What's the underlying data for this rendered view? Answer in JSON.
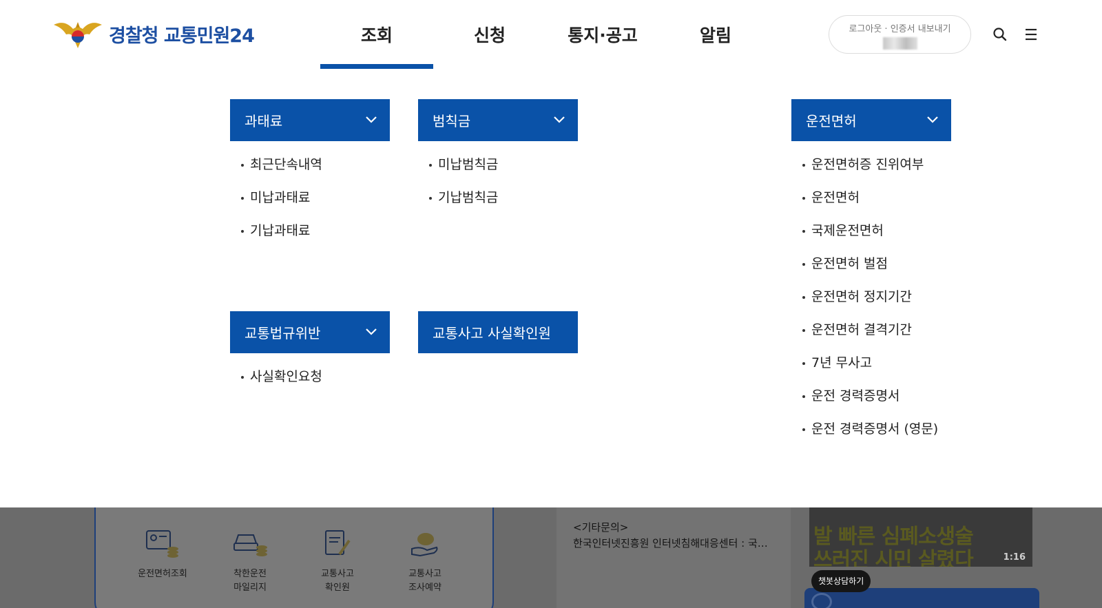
{
  "header": {
    "logo_text": "경찰청 교통민원24",
    "nav": [
      {
        "label": "조회",
        "active": true
      },
      {
        "label": "신청",
        "active": false
      },
      {
        "label": "통지·공고",
        "active": false
      },
      {
        "label": "알림",
        "active": false
      }
    ],
    "auth_text": "로그아웃 · 인증서 내보내기",
    "icons": {
      "search": "search-icon",
      "menu": "hamburger-menu-icon"
    }
  },
  "mega_menu": {
    "categories": [
      {
        "title": "과태료",
        "expandable": true,
        "items": [
          "최근단속내역",
          "미납과태료",
          "기납과태료"
        ]
      },
      {
        "title": "범칙금",
        "expandable": true,
        "items": [
          "미납범칙금",
          "기납범칙금"
        ]
      },
      {
        "title": "운전면허",
        "expandable": true,
        "items": [
          "운전면허증 진위여부",
          "운전면허",
          "국제운전면허",
          "운전면허 벌점",
          "운전면허 정지기간",
          "운전면허 결격기간",
          "7년 무사고",
          "운전 경력증명서",
          "운전 경력증명서 (영문)"
        ]
      },
      {
        "title": "교통법규위반",
        "expandable": true,
        "items": [
          "사실확인요청"
        ]
      },
      {
        "title": "교통사고 사실확인원",
        "expandable": false,
        "items": []
      }
    ]
  },
  "background": {
    "quick_menu": [
      {
        "line1": "운전면허조회",
        "line2": "",
        "icon": "license-coins-icon"
      },
      {
        "line1": "착한운전",
        "line2": "마일리지",
        "icon": "car-coins-icon"
      },
      {
        "line1": "교통사고",
        "line2": "확인원",
        "icon": "document-pen-icon"
      },
      {
        "line1": "교통사고",
        "line2": "조사예약",
        "icon": "hand-piggybank-icon"
      }
    ],
    "notice_tag": "<기타문의>",
    "notice_text": "한국인터넷진흥원 인터넷침해대응센터 : 국…",
    "video_caption_line1": "발 빠른 심폐소생술",
    "video_caption_line2": "쓰러진 시민 살렸다",
    "video_duration": "1:16",
    "chatbot_label": "챗봇상담하기"
  },
  "colors": {
    "primary": "#0a52a8",
    "dim_overlay": "#6b6b6b"
  }
}
